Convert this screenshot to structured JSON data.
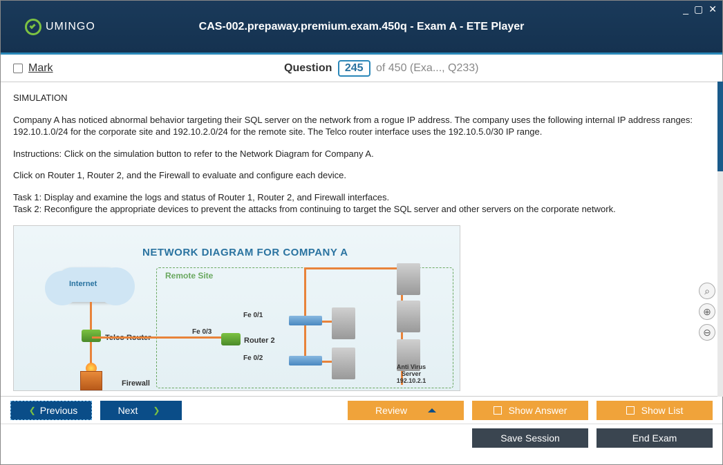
{
  "window": {
    "logo_text": "UMINGO",
    "title": "CAS-002.prepaway.premium.exam.450q - Exam A - ETE Player"
  },
  "question_bar": {
    "mark_label": "Mark",
    "word": "Question",
    "current": "245",
    "rest": "of 450 (Exa..., Q233)"
  },
  "content": {
    "sim": "SIMULATION",
    "p1": "Company A has noticed abnormal behavior targeting their SQL server on the network from a rogue IP address. The company uses the following internal IP address ranges: 192.10.1.0/24 for the corporate site and 192.10.2.0/24 for the remote site. The Telco router interface uses the 192.10.5.0/30 IP range.",
    "p2": "Instructions: Click on the simulation button to refer to the Network Diagram for Company A.",
    "p3": "Click on Router 1, Router 2, and the Firewall to evaluate and configure each device.",
    "p4": "Task 1: Display and examine the logs and status of Router 1, Router 2, and Firewall interfaces.\nTask 2: Reconfigure the appropriate devices to prevent the attacks from continuing to target the SQL server and other servers on the corporate network."
  },
  "diagram": {
    "title": "NETWORK DIAGRAM FOR COMPANY A",
    "remote": "Remote Site",
    "internet": "Internet",
    "telco": "Telco Router",
    "firewall": "Firewall",
    "router2": "Router 2",
    "fe01": "Fe 0/1",
    "fe02": "Fe 0/2",
    "fe03": "Fe 0/3",
    "av": "Anti Virus\nServer\n192.10.2.1"
  },
  "nav": {
    "previous": "Previous",
    "next": "Next",
    "review": "Review",
    "show_answer": "Show Answer",
    "show_list": "Show List",
    "save_session": "Save Session",
    "end_exam": "End Exam"
  }
}
